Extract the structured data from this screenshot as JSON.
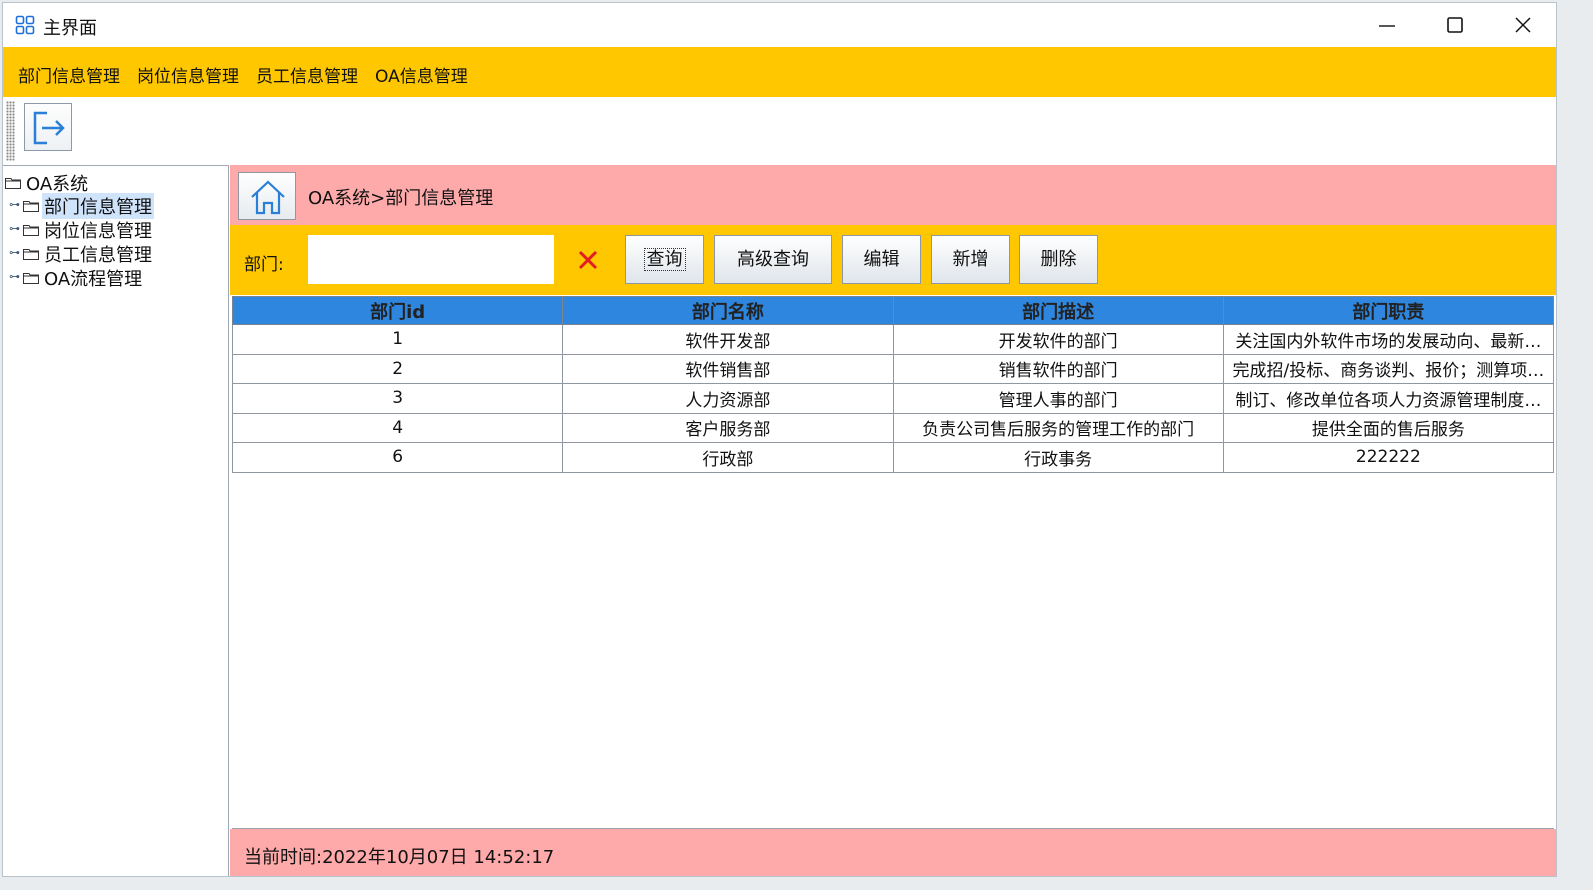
{
  "window": {
    "title": "主界面",
    "icon": "app-grid-icon",
    "controls": [
      "minimize-icon",
      "maximize-icon",
      "close-icon"
    ]
  },
  "menubar": {
    "items": [
      "部门信息管理",
      "岗位信息管理",
      "员工信息管理",
      "OA信息管理"
    ]
  },
  "toolbar": {
    "exit_icon": "exit-icon"
  },
  "tree": {
    "root": "OA系统",
    "children": [
      "部门信息管理",
      "岗位信息管理",
      "员工信息管理",
      "OA流程管理"
    ],
    "selected": "部门信息管理"
  },
  "breadcrumb": {
    "text": "OA系统>部门信息管理",
    "home_icon": "home-icon"
  },
  "search": {
    "label": "部门:",
    "value": "",
    "clear_icon": "clear-x-icon",
    "buttons": {
      "query": "查询",
      "advanced": "高级查询",
      "edit": "编辑",
      "add": "新增",
      "delete": "删除"
    }
  },
  "table": {
    "headers": [
      "部门id",
      "部门名称",
      "部门描述",
      "部门职责"
    ],
    "rows": [
      [
        "1",
        "软件开发部",
        "开发软件的部门",
        "关注国内外软件市场的发展动向、最新…"
      ],
      [
        "2",
        "软件销售部",
        "销售软件的部门",
        "完成招/投标、商务谈判、报价；测算项…"
      ],
      [
        "3",
        "人力资源部",
        "管理人事的部门",
        "制订、修改单位各项人力资源管理制度…"
      ],
      [
        "4",
        "客户服务部",
        "负责公司售后服务的管理工作的部门",
        "提供全面的售后服务"
      ],
      [
        "6",
        "行政部",
        "行政事务",
        "222222"
      ]
    ]
  },
  "status": {
    "text": "当前时间:2022年10月07日 14:52:17"
  },
  "colors": {
    "menubar": "#ffc700",
    "breadcrumb_bar": "#ffaaaa",
    "table_header": "#2e86de",
    "clear_icon": "#e02020"
  }
}
